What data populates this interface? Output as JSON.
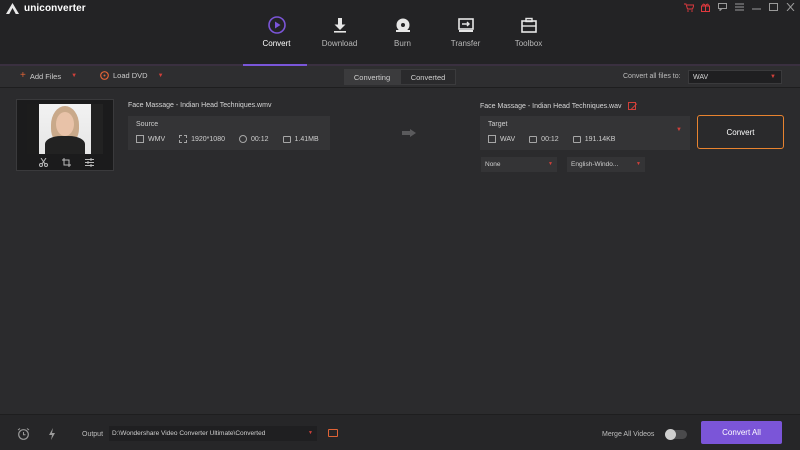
{
  "app": {
    "title": "uniconverter"
  },
  "window_controls": [
    {
      "icon": "cart-icon",
      "glyph": "🛒"
    },
    {
      "icon": "gift-icon",
      "glyph": "✉"
    },
    {
      "icon": "feedback-icon",
      "glyph": "✉"
    },
    {
      "icon": "menu-icon",
      "glyph": "≡"
    },
    {
      "icon": "minimize-icon",
      "glyph": "—"
    },
    {
      "icon": "maximize-icon",
      "glyph": "□"
    },
    {
      "icon": "close-icon",
      "glyph": "✕"
    }
  ],
  "nav": {
    "tabs": [
      {
        "label": "Convert",
        "icon": "convert-icon",
        "active": true
      },
      {
        "label": "Download",
        "icon": "download-icon",
        "active": false
      },
      {
        "label": "Burn",
        "icon": "burn-icon",
        "active": false
      },
      {
        "label": "Transfer",
        "icon": "transfer-icon",
        "active": false
      },
      {
        "label": "Toolbox",
        "icon": "toolbox-icon",
        "active": false
      }
    ]
  },
  "toolbar": {
    "add_files": "Add Files",
    "load_dvd": "Load DVD",
    "seg_converting": "Converting",
    "seg_converted": "Converted",
    "convert_all_label": "Convert all files to:",
    "convert_all_format": "WAV"
  },
  "file": {
    "source_name": "Face Massage - Indian Head Techniques.wmv",
    "source_header": "Source",
    "source_format": "WMV",
    "source_resolution": "1920*1080",
    "source_duration": "00:12",
    "source_size": "1.41MB",
    "target_name": "Face Massage - Indian Head Techniques.wav",
    "target_header": "Target",
    "target_format": "WAV",
    "target_duration": "00:12",
    "target_size": "191.14KB",
    "subtitle_option": "None",
    "audio_option": "English-Windo...",
    "convert_button": "Convert"
  },
  "bottom": {
    "output_label": "Output",
    "output_path": "D:\\Wondershare Video Converter Ultimate\\Converted",
    "merge_label": "Merge All Videos",
    "merge_enabled": false,
    "convert_all_button": "Convert All"
  },
  "colors": {
    "accent": "#7b55d8",
    "convert_border": "#e8832f",
    "caret_red": "#d0403a"
  }
}
